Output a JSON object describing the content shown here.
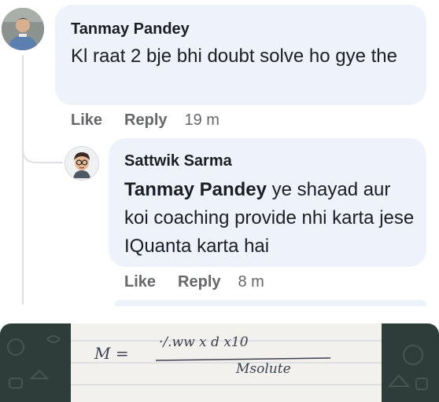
{
  "comments": [
    {
      "author": "Tanmay Pandey",
      "text": "Kl raat 2 bje bhi doubt solve ho gye the",
      "like_label": "Like",
      "reply_label": "Reply",
      "time": "19 m"
    }
  ],
  "reply": {
    "author": "Sattwik Sarma",
    "mention": "Tanmay Pandey",
    "text": " ye shayad aur koi coaching provide nhi karta jese IQuanta karta hai",
    "like_label": "Like",
    "reply_label": "Reply",
    "time": "8 m"
  },
  "photo": {
    "line1_left": "M =",
    "line1_right": "·/.ww  x  d x10",
    "line2": "Msolute"
  },
  "colors": {
    "bubble": "#eef2fb",
    "meta": "#65676b",
    "text": "#1c1e21",
    "thread_line": "#dcdfe3"
  }
}
